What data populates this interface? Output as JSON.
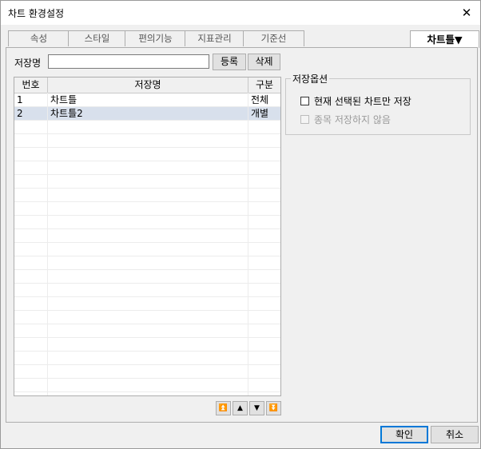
{
  "window": {
    "title": "차트 환경설정"
  },
  "tabs": [
    "속성",
    "스타일",
    "편의기능",
    "지표관리",
    "기준선"
  ],
  "active_tab": "차트틀▼",
  "save_name": {
    "label": "저장명",
    "value": "",
    "register_label": "등록",
    "delete_label": "삭제"
  },
  "table": {
    "headers": [
      "번호",
      "저장명",
      "구분"
    ],
    "rows": [
      {
        "no": "1",
        "name": "차트틀",
        "type": "전체",
        "selected": false
      },
      {
        "no": "2",
        "name": "차트틀2",
        "type": "개별",
        "selected": true
      }
    ]
  },
  "options": {
    "title": "저장옵션",
    "save_selected_only": "현재 선택된 차트만 저장",
    "no_save_symbol": "종목 저장하지 않음"
  },
  "nav_icons": [
    "move-top-icon",
    "move-up-icon",
    "move-down-icon",
    "move-bottom-icon"
  ],
  "footer": {
    "ok_label": "확인",
    "cancel_label": "취소"
  }
}
